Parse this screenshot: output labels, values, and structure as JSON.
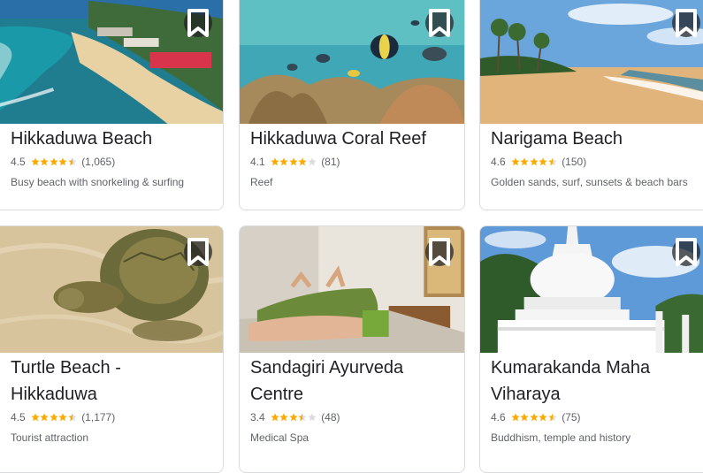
{
  "colors": {
    "star": "#f9ab00",
    "star_empty": "#dadce0"
  },
  "icons": {
    "save": "bookmark-icon"
  },
  "places": [
    {
      "name": "Hikkaduwa Beach",
      "rating": "4.5",
      "rating_value": 4.5,
      "reviews": "(1,065)",
      "description": "Busy beach with snorkeling & surfing"
    },
    {
      "name": "Hikkaduwa Coral Reef",
      "rating": "4.1",
      "rating_value": 4.1,
      "reviews": "(81)",
      "description": "Reef"
    },
    {
      "name": "Narigama Beach",
      "rating": "4.6",
      "rating_value": 4.6,
      "reviews": "(150)",
      "description": "Golden sands, surf, sunsets & beach bars"
    },
    {
      "name": "Turtle Beach - Hikkaduwa",
      "rating": "4.5",
      "rating_value": 4.5,
      "reviews": "(1,177)",
      "description": "Tourist attraction"
    },
    {
      "name": "Sandagiri Ayurveda Centre",
      "rating": "3.4",
      "rating_value": 3.4,
      "reviews": "(48)",
      "description": "Medical Spa"
    },
    {
      "name": "Kumarakanda Maha Viharaya",
      "rating": "4.6",
      "rating_value": 4.6,
      "reviews": "(75)",
      "description": "Buddhism, temple and history"
    }
  ]
}
